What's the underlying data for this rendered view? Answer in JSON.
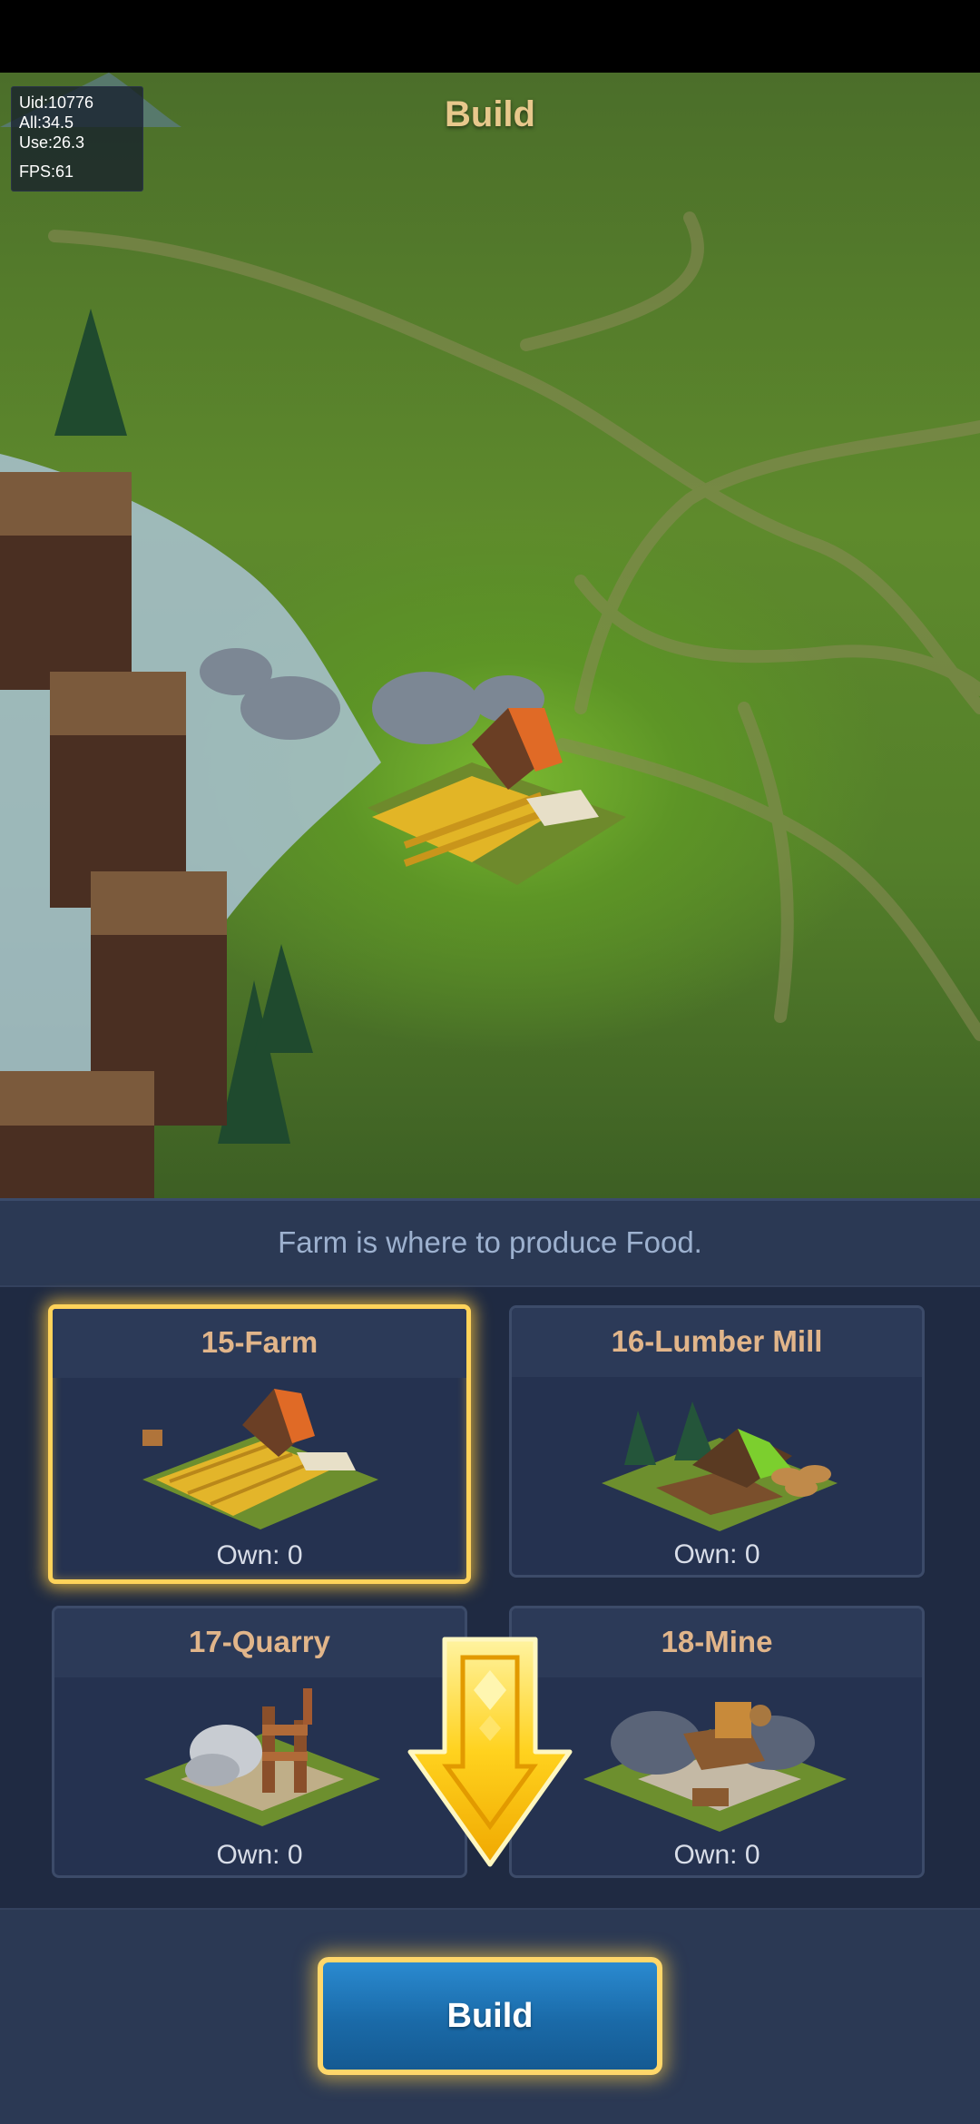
{
  "screen": {
    "title": "Build",
    "description": "Farm is where to produce Food."
  },
  "debug_overlay": {
    "uid": "Uid:10776",
    "all": "All:34.5",
    "use": "Use:26.3",
    "fps": "FPS:61"
  },
  "buildings": [
    {
      "name": "15-Farm",
      "own": "Own: 0",
      "selected": true,
      "icon": "farm-icon"
    },
    {
      "name": "16-Lumber Mill",
      "own": "Own: 0",
      "selected": false,
      "icon": "lumber-mill-icon"
    },
    {
      "name": "17-Quarry",
      "own": "Own: 0",
      "selected": false,
      "icon": "quarry-icon"
    },
    {
      "name": "18-Mine",
      "own": "Own: 0",
      "selected": false,
      "icon": "mine-icon"
    }
  ],
  "actions": {
    "build_label": "Build"
  },
  "colors": {
    "panel": "#2b3954",
    "card": "#253250",
    "title": "#e8c88c",
    "card_title": "#e1b58a",
    "highlight": "#ffd35a",
    "button": "#1a6aa8"
  }
}
